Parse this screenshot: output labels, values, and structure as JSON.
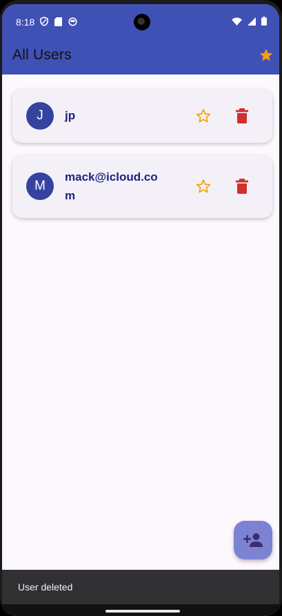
{
  "status_bar": {
    "time": "8:18",
    "left_icons": [
      "shield-icon",
      "sd-card-icon",
      "sync-icon"
    ],
    "right_icons": [
      "wifi-icon",
      "signal-icon",
      "battery-icon"
    ]
  },
  "app_bar": {
    "title": "All Users",
    "action_icon": "star-filled-icon"
  },
  "users": [
    {
      "initial": "J",
      "name": "jp",
      "favorite": false
    },
    {
      "initial": "M",
      "name": "mack@icloud.com",
      "favorite": false
    }
  ],
  "fab": {
    "icon": "person-add-icon"
  },
  "snackbar": {
    "message": "User deleted"
  },
  "colors": {
    "primary": "#3f51b5",
    "avatar": "#3443a0",
    "name_text": "#1a237e",
    "star": "#f59e0b",
    "delete": "#d32f2f",
    "fab": "#7b83d2",
    "snackbar": "#313033"
  }
}
